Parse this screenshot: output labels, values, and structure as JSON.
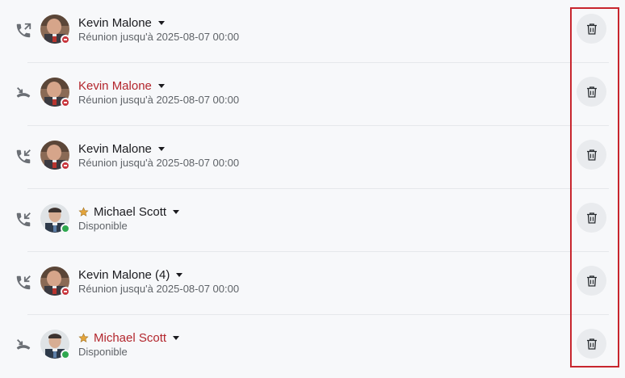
{
  "colors": {
    "missed_text": "#b3262d",
    "highlight_border": "#c8262e",
    "busy": "#c8343b",
    "available": "#2fa84f"
  },
  "calls": [
    {
      "direction": "outgoing",
      "call_icon": "phone-outgoing-icon",
      "name": "Kevin Malone",
      "missed": false,
      "favorite": false,
      "avatar": "kevin",
      "presence": "busy",
      "status": "Réunion jusqu'à 2025-08-07 00:00",
      "delete_icon": "trash-icon"
    },
    {
      "direction": "missed",
      "call_icon": "phone-missed-icon",
      "name": "Kevin Malone",
      "missed": true,
      "favorite": false,
      "avatar": "kevin",
      "presence": "busy",
      "status": "Réunion jusqu'à 2025-08-07 00:00",
      "delete_icon": "trash-icon"
    },
    {
      "direction": "incoming",
      "call_icon": "phone-incoming-icon",
      "name": "Kevin Malone",
      "missed": false,
      "favorite": false,
      "avatar": "kevin",
      "presence": "busy",
      "status": "Réunion jusqu'à 2025-08-07 00:00",
      "delete_icon": "trash-icon"
    },
    {
      "direction": "incoming",
      "call_icon": "phone-incoming-icon",
      "name": "Michael Scott",
      "missed": false,
      "favorite": true,
      "avatar": "michael",
      "presence": "available",
      "status": "Disponible",
      "delete_icon": "trash-icon"
    },
    {
      "direction": "incoming",
      "call_icon": "phone-incoming-icon",
      "name": "Kevin Malone (4)",
      "missed": false,
      "favorite": false,
      "avatar": "kevin",
      "presence": "busy",
      "status": "Réunion jusqu'à 2025-08-07 00:00",
      "delete_icon": "trash-icon"
    },
    {
      "direction": "missed",
      "call_icon": "phone-missed-icon",
      "name": "Michael Scott",
      "missed": true,
      "favorite": true,
      "avatar": "michael",
      "presence": "available",
      "status": "Disponible",
      "delete_icon": "trash-icon"
    }
  ]
}
